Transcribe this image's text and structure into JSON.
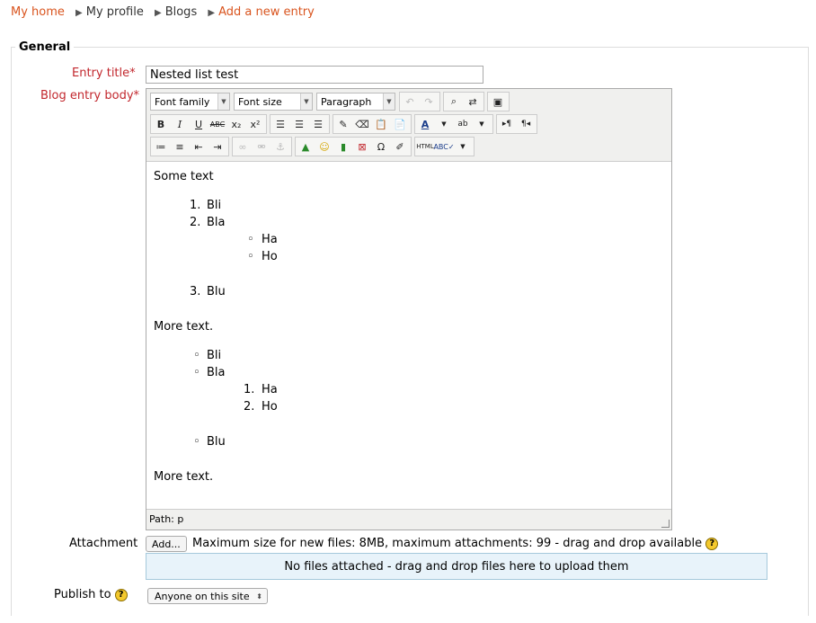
{
  "breadcrumb": {
    "home": "My home",
    "profile": "My profile",
    "blogs": "Blogs",
    "current": "Add a new entry",
    "separator": "▶"
  },
  "form": {
    "legend": "General",
    "entry_title_label": "Entry title",
    "entry_title_value": "Nested list test",
    "body_label": "Blog entry body",
    "required_mark": "*",
    "attachment_label": "Attachment",
    "add_button": "Add...",
    "attachment_info": "Maximum size for new files: 8MB, maximum attachments: 99 - drag and drop available",
    "dropzone_text": "No files attached - drag and drop files here to upload them",
    "publish_label": "Publish to",
    "publish_value": "Anyone on this site",
    "help_glyph": "?"
  },
  "editor": {
    "font_family": "Font family",
    "font_size": "Font size",
    "format": "Paragraph",
    "path": "Path: p",
    "content": {
      "p1": "Some text",
      "ol1": [
        "Bli",
        "Bla",
        "Blu"
      ],
      "ol1_markers": [
        "1.",
        "2.",
        "3."
      ],
      "ul_nested": [
        "Ha",
        "Ho"
      ],
      "p2": "More text.",
      "ul2": [
        "Bli",
        "Bla",
        "Blu"
      ],
      "ol_nested": [
        "Ha",
        "Ho"
      ],
      "ol_nested_markers": [
        "1.",
        "2."
      ],
      "p3": "More text."
    }
  },
  "colors": {
    "link": "#d9541e",
    "required": "#c2272d",
    "dropzone_bg": "#e8f3fa"
  }
}
